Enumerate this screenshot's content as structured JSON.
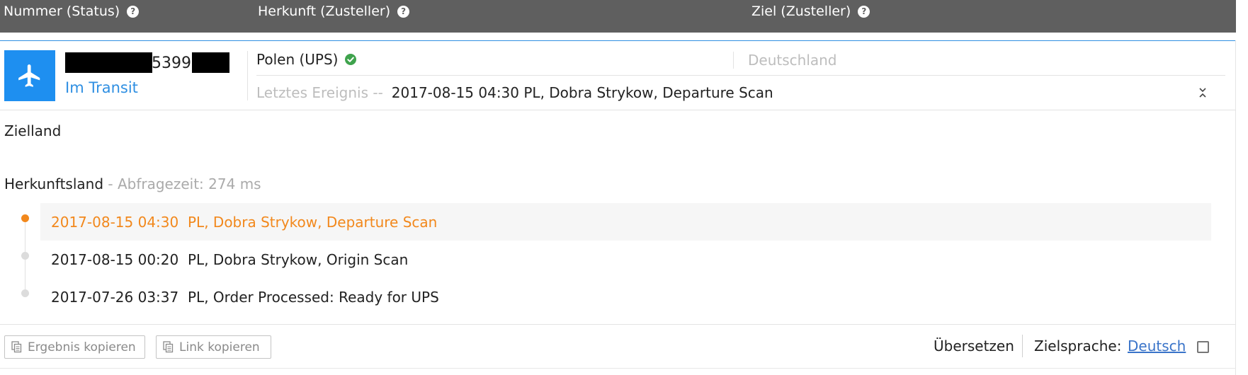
{
  "header": {
    "col_number": "Nummer (Status)",
    "col_origin": "Herkunft (Zusteller)",
    "col_destination": "Ziel (Zusteller)",
    "help_glyph": "?"
  },
  "shipment": {
    "carrier_icon": "airplane-icon",
    "tracking_visible_digits": "53994",
    "status": "Im Transit",
    "origin": "Polen (UPS)",
    "origin_verified_icon": "check-circle-icon",
    "destination": "Deutschland",
    "last_event_label": "Letztes Ereignis --",
    "last_event_value": "2017-08-15 04:30 PL, Dobra Strykow, Departure Scan",
    "collapse_icon": "chevron-collapse-icon"
  },
  "sections": {
    "destination_country": "Zielland",
    "origin_country": "Herkunftsland",
    "query_time": " - Abfragezeit: 274 ms"
  },
  "events": [
    {
      "time": "2017-08-15 04:30",
      "desc": "PL, Dobra Strykow, Departure Scan"
    },
    {
      "time": "2017-08-15 00:20",
      "desc": "PL, Dobra Strykow, Origin Scan"
    },
    {
      "time": "2017-07-26 03:37",
      "desc": "PL, Order Processed: Ready for UPS"
    }
  ],
  "footer": {
    "copy_result": "Ergebnis kopieren",
    "copy_link": "Link kopieren",
    "translate": "Übersetzen",
    "target_language_label": "Zielsprache:",
    "target_language": "Deutsch"
  },
  "colors": {
    "header_bg": "#5f5f5f",
    "accent_blue": "#1e8ff0",
    "active_orange": "#f2881c",
    "verified_green": "#3fa34d"
  }
}
